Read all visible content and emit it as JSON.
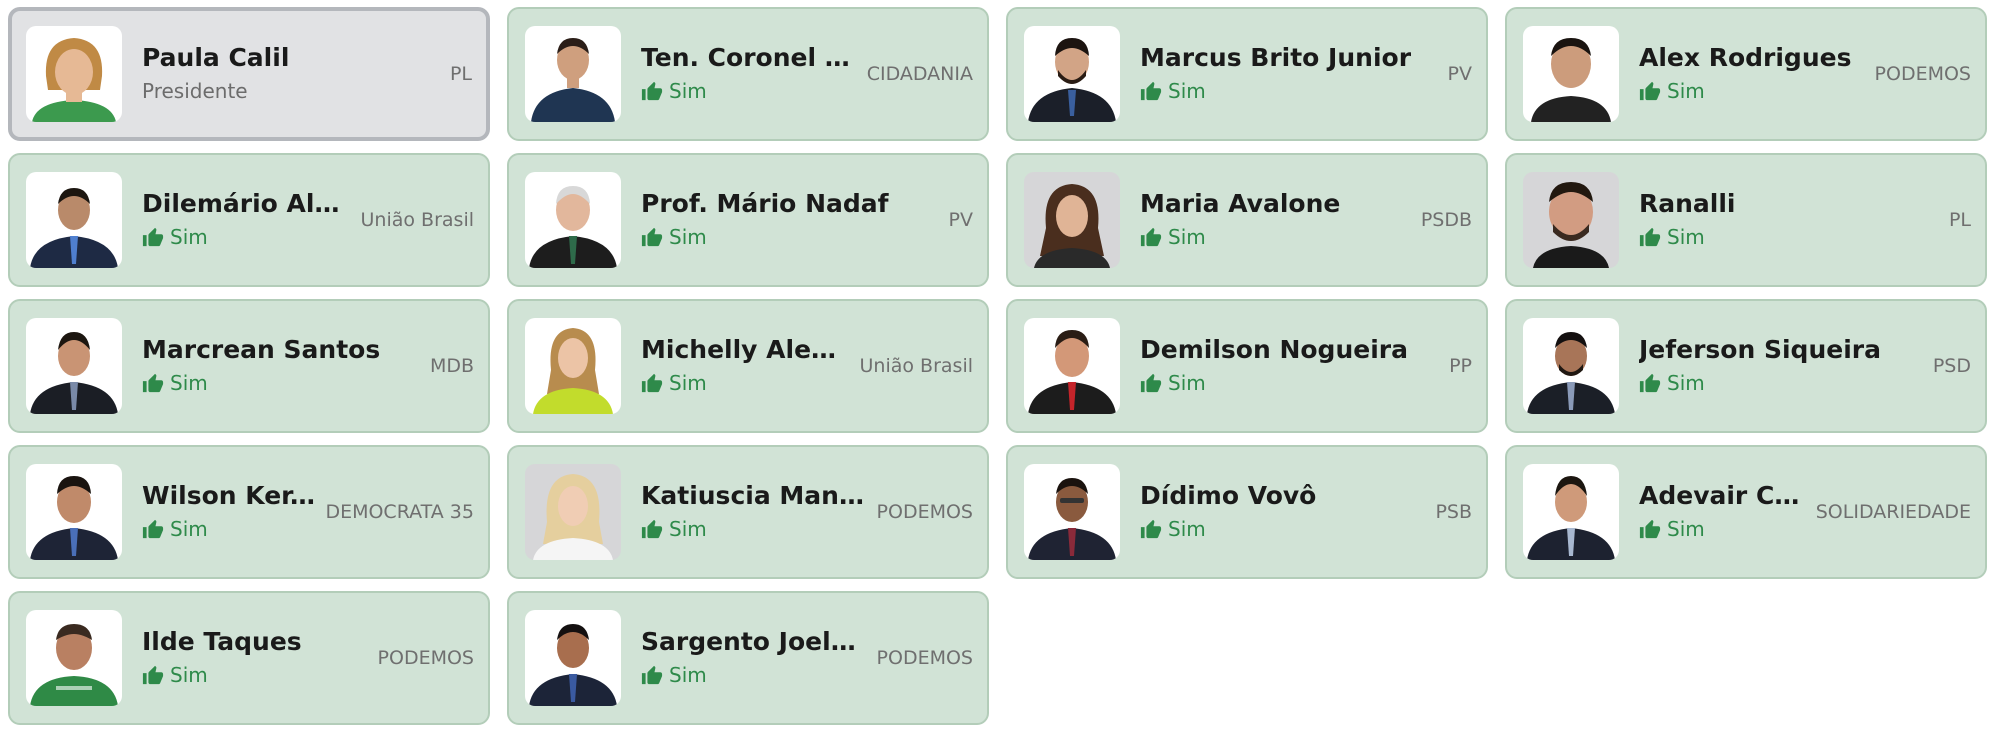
{
  "colors": {
    "card_bg": "#d1e3d6",
    "card_border": "#b3cdb9",
    "president_bg": "#e1e2e4",
    "president_border": "#b4b7bc",
    "vote_yes": "#2e8a4a"
  },
  "members": [
    {
      "name": "Paula Calil",
      "role": "Presidente",
      "party": "PL"
    },
    {
      "name": "Ten. Coronel D...",
      "vote": "Sim",
      "vote_icon": "thumbs-up-icon",
      "party": "CIDADANIA"
    },
    {
      "name": "Marcus Brito Junior",
      "vote": "Sim",
      "vote_icon": "thumbs-up-icon",
      "party": "PV"
    },
    {
      "name": "Alex Rodrigues",
      "vote": "Sim",
      "vote_icon": "thumbs-up-icon",
      "party": "PODEMOS"
    },
    {
      "name": "Dilemário Ale...",
      "vote": "Sim",
      "vote_icon": "thumbs-up-icon",
      "party": "União Brasil"
    },
    {
      "name": "Prof. Mário Nadaf",
      "vote": "Sim",
      "vote_icon": "thumbs-up-icon",
      "party": "PV"
    },
    {
      "name": "Maria Avalone",
      "vote": "Sim",
      "vote_icon": "thumbs-up-icon",
      "party": "PSDB"
    },
    {
      "name": "Ranalli",
      "vote": "Sim",
      "vote_icon": "thumbs-up-icon",
      "party": "PL"
    },
    {
      "name": "Marcrean Santos",
      "vote": "Sim",
      "vote_icon": "thumbs-up-icon",
      "party": "MDB"
    },
    {
      "name": "Michelly Alencar",
      "vote": "Sim",
      "vote_icon": "thumbs-up-icon",
      "party": "União Brasil"
    },
    {
      "name": "Demilson Nogueira",
      "vote": "Sim",
      "vote_icon": "thumbs-up-icon",
      "party": "PP"
    },
    {
      "name": "Jeferson Siqueira",
      "vote": "Sim",
      "vote_icon": "thumbs-up-icon",
      "party": "PSD"
    },
    {
      "name": "Wilson Ker...",
      "vote": "Sim",
      "vote_icon": "thumbs-up-icon",
      "party": "DEMOCRATA 35"
    },
    {
      "name": "Katiuscia Manteli",
      "vote": "Sim",
      "vote_icon": "thumbs-up-icon",
      "party": "PODEMOS"
    },
    {
      "name": "Dídimo Vovô",
      "vote": "Sim",
      "vote_icon": "thumbs-up-icon",
      "party": "PSB"
    },
    {
      "name": "Adevair Ca...",
      "vote": "Sim",
      "vote_icon": "thumbs-up-icon",
      "party": "SOLIDARIEDADE"
    },
    {
      "name": "Ilde Taques",
      "vote": "Sim",
      "vote_icon": "thumbs-up-icon",
      "party": "PODEMOS"
    },
    {
      "name": "Sargento Joelson",
      "vote": "Sim",
      "vote_icon": "thumbs-up-icon",
      "party": "PODEMOS"
    }
  ]
}
